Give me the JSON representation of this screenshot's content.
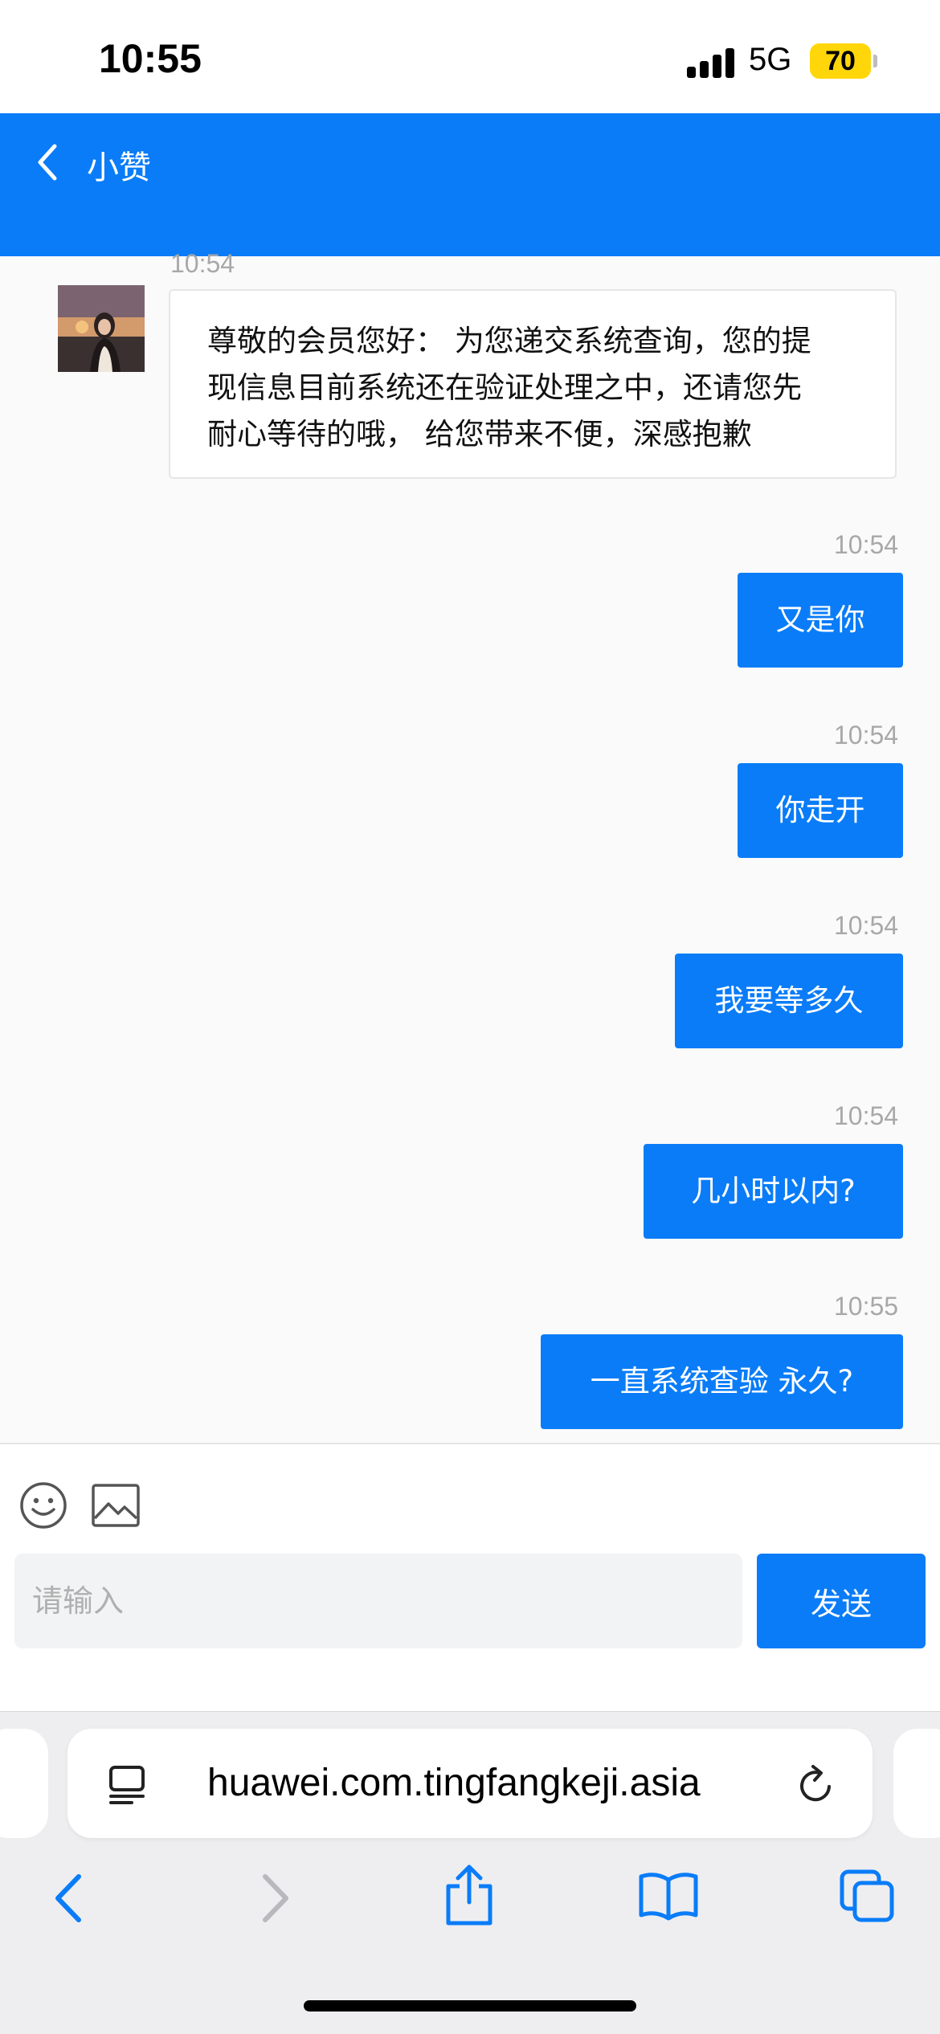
{
  "status_bar": {
    "time": "10:55",
    "network": "5G",
    "battery": "70",
    "battery_color": "#ffd60a"
  },
  "header": {
    "title": "小赞",
    "back_icon": "chevron-left-icon",
    "background": "#0a7cf8"
  },
  "messages": [
    {
      "direction": "incoming",
      "time": "10:54",
      "text": [
        "尊敬的会员您好： 为您递交系统查询，您的提",
        "现信息目前系统还在验证处理之中，还请您先",
        "耐心等待的哦， 给您带来不便，深感抱歉"
      ]
    },
    {
      "direction": "outgoing",
      "time": "10:54",
      "text": "又是你"
    },
    {
      "direction": "outgoing",
      "time": "10:54",
      "text": "你走开"
    },
    {
      "direction": "outgoing",
      "time": "10:54",
      "text": "我要等多久"
    },
    {
      "direction": "outgoing",
      "time": "10:54",
      "text": "几小时以内?"
    },
    {
      "direction": "outgoing",
      "time": "10:55",
      "text": "一直系统查验 永久?"
    }
  ],
  "composer": {
    "placeholder": "请输入",
    "send_label": "发送",
    "emoji_icon": "smiley-icon",
    "image_icon": "image-icon"
  },
  "browser": {
    "url": "huawei.com.tingfangkeji.asia",
    "icons": [
      "reader-mode-icon",
      "reload-icon",
      "back-icon",
      "forward-icon",
      "share-icon",
      "bookmarks-icon",
      "tabs-icon"
    ]
  }
}
